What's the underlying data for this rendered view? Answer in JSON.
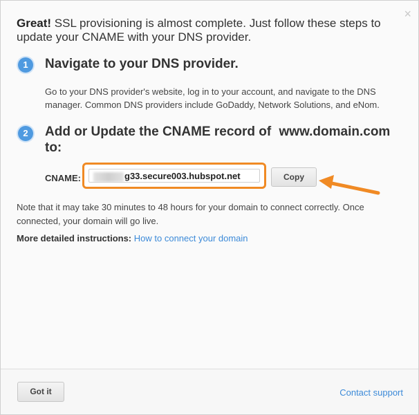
{
  "dialog": {
    "close_glyph": "×",
    "intro_bold": "Great!",
    "intro_text": " SSL provisioning is almost complete. Just follow these steps to update your CNAME with your DNS provider."
  },
  "steps": [
    {
      "number": "1",
      "title": "Navigate to your DNS provider.",
      "description": "Go to your DNS provider's website, log in to your account, and navigate to the DNS manager. Common DNS providers include GoDaddy, Network Solutions, and eNom."
    },
    {
      "number": "2",
      "title_line1": "Add or Update the CNAME record of",
      "domain": "www.domain.com",
      "title_line2": "to:"
    }
  ],
  "cname": {
    "label": "CNAME:",
    "value_visible": "g33.secure003.hubspot.net",
    "copy_label": "Copy"
  },
  "note": "Note that it may take 30 minutes to 48 hours for your domain to connect correctly. Once connected, your domain will go live.",
  "more": {
    "label": "More detailed instructions:",
    "link": "How to connect your domain"
  },
  "footer": {
    "got_it": "Got it",
    "support": "Contact support"
  },
  "colors": {
    "accent_blue": "#4f9ae0",
    "link_blue": "#3c8ad8",
    "highlight_orange": "#f08a24"
  },
  "icons": {
    "close": "close-icon",
    "arrow": "annotation-arrow-icon"
  }
}
